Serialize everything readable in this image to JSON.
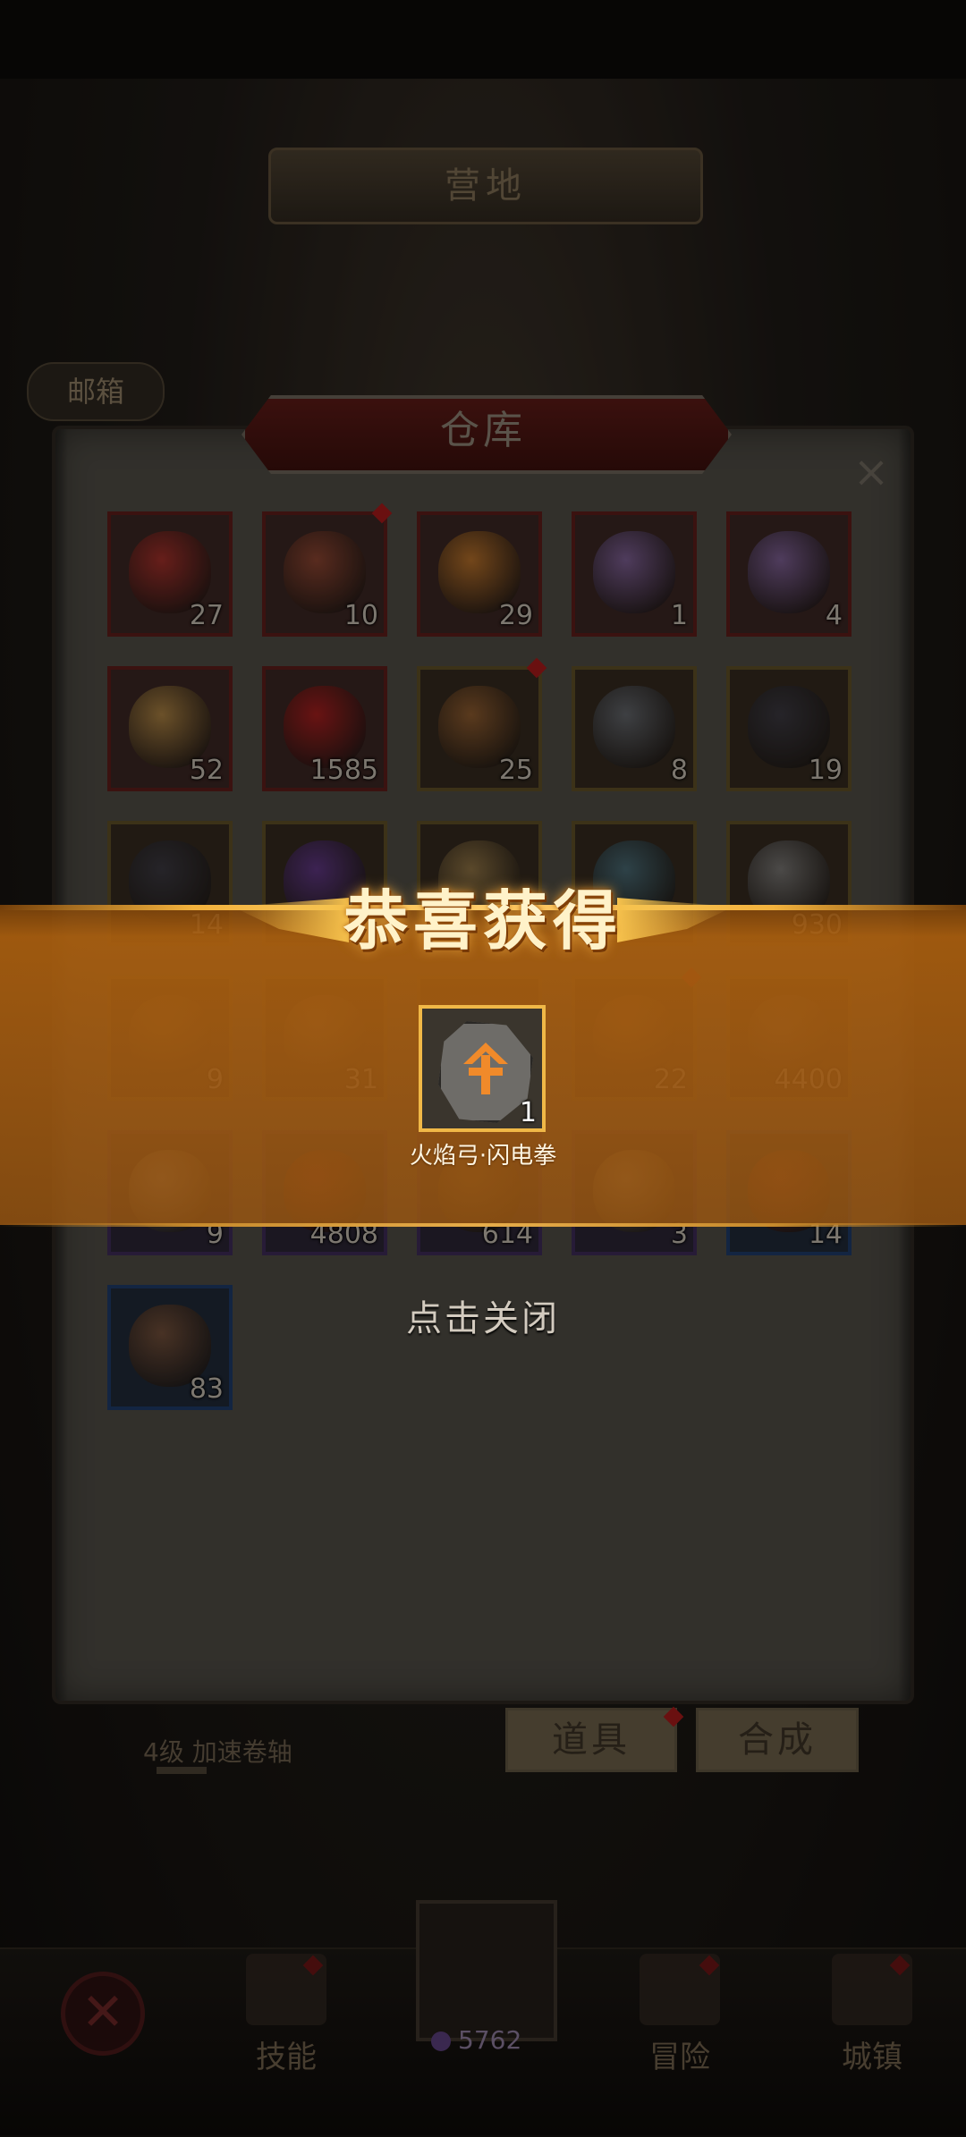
{
  "scene": {
    "title": "营地",
    "mailbox_label": "邮箱",
    "scroll_item_label": "4级 加速卷轴",
    "gem_count": "5762",
    "nav": [
      {
        "label": "技能",
        "badge": true
      },
      {
        "label": "冒险",
        "badge": true
      },
      {
        "label": "城镇",
        "badge": true
      }
    ]
  },
  "storage": {
    "title": "仓库",
    "close_label": "×",
    "items": [
      {
        "name": "red-heart-gem",
        "count": "27",
        "rarity": "red",
        "color": "#c0322b"
      },
      {
        "name": "red-armor",
        "count": "10",
        "rarity": "red",
        "color": "#a34d34",
        "badge": true
      },
      {
        "name": "orange-heart-gem",
        "count": "29",
        "rarity": "red",
        "color": "#d9852b"
      },
      {
        "name": "rainbow-crystal",
        "count": "1",
        "rarity": "red",
        "color": "#8f6fb3"
      },
      {
        "name": "rainbow-crystal",
        "count": "4",
        "rarity": "red",
        "color": "#8f6fb3"
      },
      {
        "name": "golden-feather",
        "count": "52",
        "rarity": "red",
        "color": "#c99a4a"
      },
      {
        "name": "red-crystal",
        "count": "1585",
        "rarity": "red",
        "color": "#c41c1c"
      },
      {
        "name": "orange-armor",
        "count": "25",
        "rarity": "gold",
        "color": "#a86a33",
        "badge": true
      },
      {
        "name": "spell-book",
        "count": "8",
        "rarity": "gold",
        "color": "#6f7680"
      },
      {
        "name": "dark-ore",
        "count": "19",
        "rarity": "gold",
        "color": "#3d3d4a"
      },
      {
        "name": "dark-ore",
        "count": "14",
        "rarity": "gold",
        "color": "#3d3d4a"
      },
      {
        "name": "purple-flame",
        "count": "",
        "rarity": "gold",
        "color": "#6b3aa0"
      },
      {
        "name": "scroll-map",
        "count": "",
        "rarity": "gold",
        "color": "#a8874e"
      },
      {
        "name": "rune-tile",
        "count": "",
        "rarity": "gold",
        "color": "#4d7a8a"
      },
      {
        "name": "crossed-swords-medal",
        "count": "930",
        "rarity": "gold",
        "color": "#8a8a8a"
      },
      {
        "name": "compass-wheel",
        "count": "9",
        "rarity": "gold",
        "color": "#8a6a3a"
      },
      {
        "name": "hammer",
        "count": "31",
        "rarity": "gold",
        "color": "#9a7a55"
      },
      {
        "name": "empty-slot",
        "count": "",
        "rarity": "gold",
        "color": "#5a4a30"
      },
      {
        "name": "coin-bag",
        "count": "22",
        "rarity": "gold",
        "color": "#9a6a3a",
        "badge": true
      },
      {
        "name": "gear-stone",
        "count": "4400",
        "rarity": "gold",
        "color": "#7a6a5a"
      },
      {
        "name": "white-feather",
        "count": "9",
        "rarity": "purple",
        "color": "#b9b3a8"
      },
      {
        "name": "red-shards",
        "count": "4808",
        "rarity": "purple",
        "color": "#a82a22"
      },
      {
        "name": "wood-logs",
        "count": "614",
        "rarity": "purple",
        "color": "#8a6a3a"
      },
      {
        "name": "parchment",
        "count": "3",
        "rarity": "purple",
        "color": "#c9b48a"
      },
      {
        "name": "red-ore",
        "count": "14",
        "rarity": "blue",
        "color": "#a83a2a"
      },
      {
        "name": "mixed-ore-pile",
        "count": "83",
        "rarity": "blue",
        "color": "#8a5a3a"
      }
    ],
    "tabs": [
      {
        "label": "道具",
        "badge": true
      },
      {
        "label": "合成",
        "badge": false
      }
    ]
  },
  "reward": {
    "title": "恭喜获得",
    "item_count": "1",
    "item_name": "火焰弓·闪电拳",
    "close_hint": "点击关闭"
  }
}
